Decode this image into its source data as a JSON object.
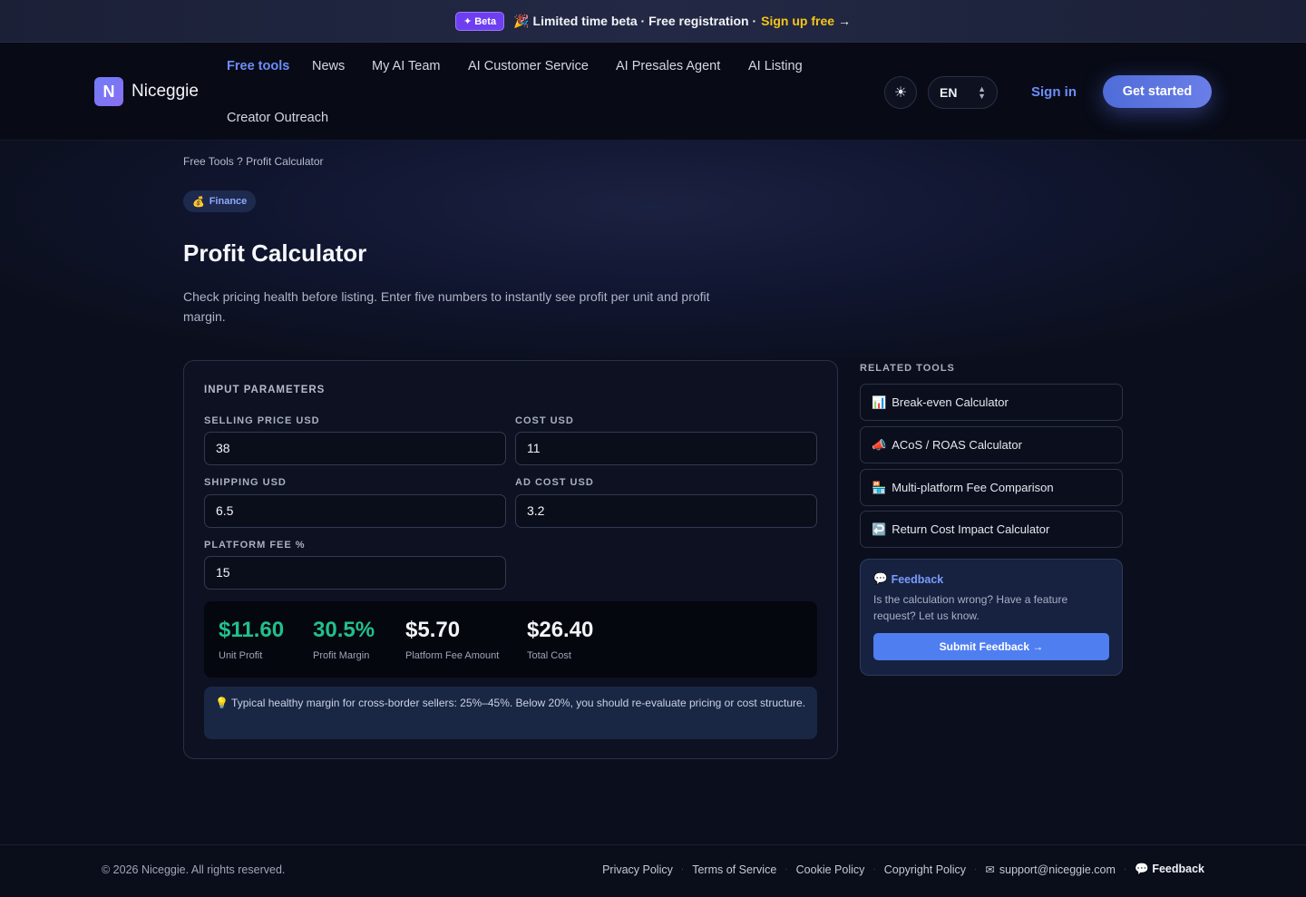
{
  "banner": {
    "badge": "✦ Beta",
    "emoji": "🎉",
    "text": "Limited time beta · Free registration ·",
    "cta": "Sign up free",
    "arrow": "→"
  },
  "header": {
    "logo_letter": "N",
    "logo_text": "Niceggie",
    "nav": [
      "Free tools",
      "News",
      "My AI Team",
      "AI Customer Service",
      "AI Presales Agent",
      "AI Listing",
      "Creator Outreach"
    ],
    "theme_icon": "☀",
    "language": "EN",
    "signin": "Sign in",
    "get_started": "Get started"
  },
  "breadcrumb": "Free Tools ? Profit Calculator",
  "badge": {
    "icon": "💰",
    "label": "Finance"
  },
  "title": "Profit Calculator",
  "description": "Check pricing health before listing. Enter five numbers to instantly see profit per unit and profit margin.",
  "calculator": {
    "section": "INPUT PARAMETERS",
    "fields": {
      "selling_price": {
        "label": "SELLING PRICE USD",
        "value": "38"
      },
      "cost": {
        "label": "COST USD",
        "value": "11"
      },
      "shipping": {
        "label": "SHIPPING USD",
        "value": "6.5"
      },
      "ad_cost": {
        "label": "AD COST USD",
        "value": "3.2"
      },
      "platform_fee": {
        "label": "PLATFORM FEE %",
        "value": "15"
      }
    },
    "results": {
      "unit_profit": {
        "value": "$11.60",
        "label": "Unit Profit"
      },
      "profit_margin": {
        "value": "30.5%",
        "label": "Profit Margin"
      },
      "platform_fee_amount": {
        "value": "$5.70",
        "label": "Platform Fee Amount"
      },
      "total_cost": {
        "value": "$26.40",
        "label": "Total Cost"
      }
    },
    "tip": "💡 Typical healthy margin for cross-border sellers: 25%–45%. Below 20%, you should re-evaluate pricing or cost structure."
  },
  "related": {
    "title": "RELATED TOOLS",
    "items": [
      {
        "icon": "📊",
        "label": "Break-even Calculator"
      },
      {
        "icon": "📣",
        "label": "ACoS / ROAS Calculator"
      },
      {
        "icon": "🏪",
        "label": "Multi-platform Fee Comparison"
      },
      {
        "icon": "↩️",
        "label": "Return Cost Impact Calculator"
      }
    ]
  },
  "feedback": {
    "icon": "💬",
    "title": "Feedback",
    "text": "Is the calculation wrong? Have a feature request? Let us know.",
    "button": "Submit Feedback →"
  },
  "footer": {
    "copyright": "© 2026 Niceggie. All rights reserved.",
    "links": [
      "Privacy Policy",
      "Terms of Service",
      "Cookie Policy",
      "Copyright Policy"
    ],
    "email_icon": "✉",
    "email": "support@niceggie.com",
    "feedback_icon": "💬",
    "feedback": "Feedback"
  }
}
